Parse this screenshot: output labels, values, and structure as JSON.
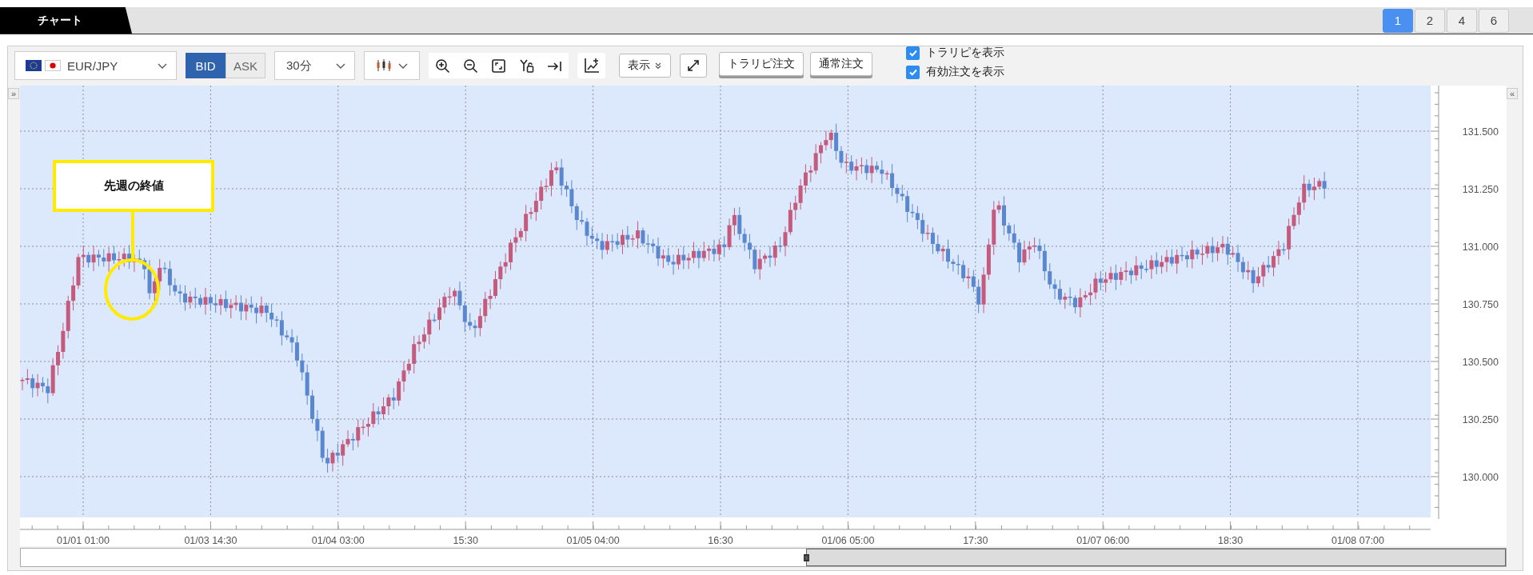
{
  "tabs": [
    {
      "label": "チャート",
      "selected": true
    }
  ],
  "layout_buttons": [
    {
      "label": "1",
      "selected": true
    },
    {
      "label": "2",
      "selected": false
    },
    {
      "label": "4",
      "selected": false
    },
    {
      "label": "6",
      "selected": false
    }
  ],
  "toolbar": {
    "pair": "EUR/JPY",
    "price_sides": [
      {
        "label": "BID",
        "selected": true
      },
      {
        "label": "ASK",
        "selected": false
      }
    ],
    "timeframe": "30分",
    "display_menu": "表示",
    "order_buttons": [
      "トラリピ注文",
      "通常注文"
    ],
    "options": [
      {
        "label": "トラリピを表示",
        "checked": true
      },
      {
        "label": "有効注文を表示",
        "checked": true
      }
    ]
  },
  "chart": {
    "collapse_left": "»",
    "collapse_right": "«",
    "y_axis_labels": [
      "131.500",
      "131.250",
      "131.000",
      "130.750",
      "130.500",
      "130.250",
      "130.000"
    ],
    "x_axis_labels": [
      "01/01 01:00",
      "01/03 14:30",
      "01/04 03:00",
      "15:30",
      "01/05 04:00",
      "16:30",
      "01/06 05:00",
      "17:30",
      "01/07 06:00",
      "18:30",
      "01/08 07:00"
    ],
    "annotation": "先週の終値"
  }
}
